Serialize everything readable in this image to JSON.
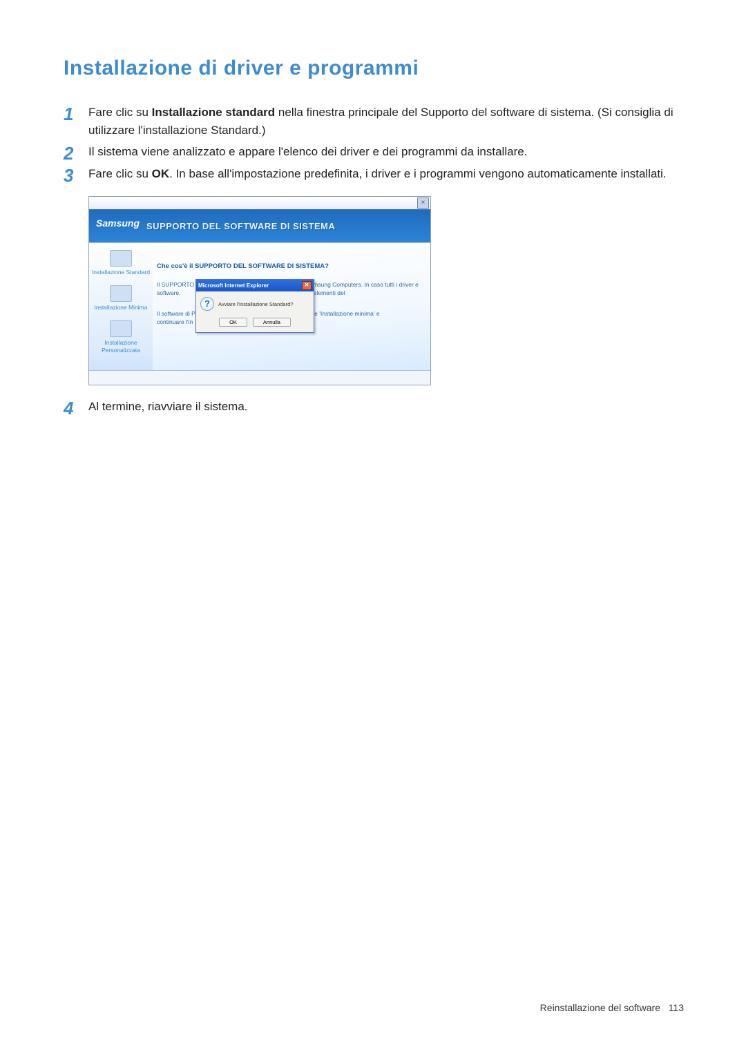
{
  "heading": "Installazione di driver e programmi",
  "steps": [
    {
      "num": "1",
      "pre": "Fare clic su ",
      "bold": "Installazione standard",
      "post": " nella finestra principale del Supporto del software di sistema. (Si consiglia di utilizzare l'installazione Standard.)"
    },
    {
      "num": "2",
      "pre": "",
      "bold": "",
      "post": "Il sistema viene analizzato e appare l'elenco dei driver e dei programmi da installare."
    },
    {
      "num": "3",
      "pre": "Fare clic su ",
      "bold": "OK",
      "post": ". In base all'impostazione predefinita, i driver e i programmi vengono automaticamente installati."
    },
    {
      "num": "4",
      "pre": "",
      "bold": "",
      "post": "Al termine, riavviare il sistema."
    }
  ],
  "illustration": {
    "brand": "Samsung",
    "banner_title": "SUPPORTO DEL SOFTWARE DI SISTEMA",
    "sidebar": [
      "Installazione Standard",
      "Installazione Minima",
      "Installazione Personalizzata"
    ],
    "question_heading": "Che cos'è il SUPPORTO DEL SOFTWARE DI SISTEMA?",
    "body_left": "Il SUPPORTO di crash del s software.",
    "body_left2": "Il software di Premere 'Inst continuare l'in",
    "body_right": "Samsung Computers. In caso tutti i driver e gli elementi del",
    "body_right2": "pure 'Installazione minima' e",
    "dialog": {
      "title": "Microsoft Internet Explorer",
      "message": "Avviare l'Installazione Standard?",
      "ok": "OK",
      "cancel": "Annulla"
    }
  },
  "footer": {
    "section": "Reinstallazione del software",
    "page": "113"
  }
}
